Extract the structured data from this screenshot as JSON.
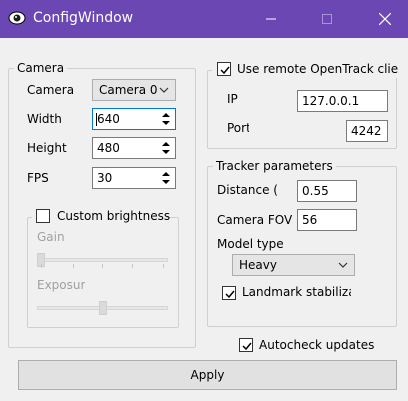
{
  "window": {
    "title": "ConfigWindow"
  },
  "camera": {
    "group_label": "Camera",
    "camera_label": "Camera",
    "camera_value": "Camera 0",
    "width_label": "Width",
    "width_value": "640",
    "height_label": "Height",
    "height_value": "480",
    "fps_label": "FPS",
    "fps_value": "30",
    "custom_brightness_label": "Custom brightness",
    "custom_brightness_checked": false,
    "gain_label": "Gain",
    "exposure_label": "Exposure",
    "gain_level": 0.0,
    "exposure_level": 0.5
  },
  "remote": {
    "use_remote_label": "Use remote OpenTrack client",
    "use_remote_checked": true,
    "ip_label": "IP",
    "ip_value": "127.0.0.1",
    "port_label": "Port",
    "port_value": "4242"
  },
  "tracker": {
    "group_label": "Tracker parameters",
    "distance_label": "Distance (m)",
    "distance_value": "0.55",
    "fov_label": "Camera FOV",
    "fov_value": "56",
    "model_type_label": "Model type",
    "model_type_value": "Heavy",
    "landmark_label": "Landmark stabilization",
    "landmark_checked": true
  },
  "footer": {
    "autocheck_label": "Autocheck updates",
    "autocheck_checked": true,
    "apply_label": "Apply"
  }
}
